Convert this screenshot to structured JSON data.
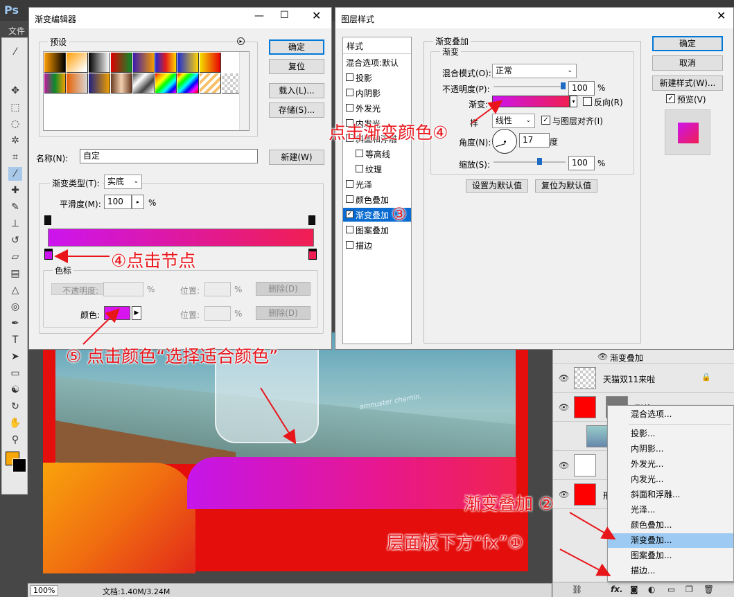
{
  "app": {
    "logo": "Ps",
    "menu_first": "文件"
  },
  "canvas": {
    "jar_text": "amnuster chemin."
  },
  "status_bar": {
    "zoom": "100%",
    "doc_info": "文档:1.40M/3.24M"
  },
  "layers_panel": {
    "effect_header": "渐变叠加",
    "rows": [
      {
        "name": "天猫双11来啦"
      },
      {
        "name": "形状 3"
      },
      {
        "name": ""
      },
      {
        "name": ""
      },
      {
        "name": "形"
      }
    ]
  },
  "fx_menu": {
    "items": [
      "混合选项...",
      "投影...",
      "内阴影...",
      "外发光...",
      "内发光...",
      "斜面和浮雕...",
      "光泽...",
      "颜色叠加...",
      "渐变叠加...",
      "图案叠加...",
      "描边..."
    ],
    "selected": "渐变叠加..."
  },
  "gradient_editor": {
    "title": "渐变编辑器",
    "presets_label": "预设",
    "buttons": {
      "ok": "确定",
      "reset": "复位",
      "load": "载入(L)...",
      "save": "存储(S)...",
      "new": "新建(W)"
    },
    "name_label": "名称(N):",
    "name_value": "自定",
    "type_label": "渐变类型(T):",
    "type_value": "实底",
    "smooth_label": "平滑度(M):",
    "smooth_value": "100",
    "smooth_unit": "%",
    "gradient_colors": {
      "start": "#cc14ee",
      "end": "#f01e52"
    },
    "stops_group": "色标",
    "opacity_label": "不透明度:",
    "opacity_unit": "%",
    "location_label": "位置:",
    "location_unit": "%",
    "delete_label": "删除(D)",
    "color_label": "颜色:",
    "color_value": "#d815ee"
  },
  "layer_style": {
    "title": "图层样式",
    "sidebar_header": "样式",
    "sidebar_items": [
      {
        "label": "混合选项:默认",
        "check": false,
        "indent": false,
        "has_box": false
      },
      {
        "label": "投影",
        "check": false,
        "indent": false,
        "has_box": true
      },
      {
        "label": "内阴影",
        "check": false,
        "indent": false,
        "has_box": true
      },
      {
        "label": "外发光",
        "check": false,
        "indent": false,
        "has_box": true
      },
      {
        "label": "内发光",
        "check": false,
        "indent": false,
        "has_box": true
      },
      {
        "label": "斜面和浮雕",
        "check": false,
        "indent": false,
        "has_box": true
      },
      {
        "label": "等高线",
        "check": false,
        "indent": true,
        "has_box": true
      },
      {
        "label": "纹理",
        "check": false,
        "indent": true,
        "has_box": true
      },
      {
        "label": "光泽",
        "check": false,
        "indent": false,
        "has_box": true
      },
      {
        "label": "颜色叠加",
        "check": false,
        "indent": false,
        "has_box": true
      },
      {
        "label": "渐变叠加",
        "check": true,
        "indent": false,
        "has_box": true,
        "selected": true
      },
      {
        "label": "图案叠加",
        "check": false,
        "indent": false,
        "has_box": true
      },
      {
        "label": "描边",
        "check": false,
        "indent": false,
        "has_box": true
      }
    ],
    "section_title": "渐变叠加",
    "subsection_title": "渐变",
    "blend_label": "混合模式(O):",
    "blend_value": "正常",
    "opacity_label": "不透明度(P):",
    "opacity_value": "100",
    "opacity_unit": "%",
    "opacity_level": 1.0,
    "gradient_label": "渐变:",
    "reverse_label": "反向(R)",
    "style_label": "样",
    "style_value": "线性",
    "align_label": "与图层对齐(I)",
    "align_checked": true,
    "angle_label": "角度(N):",
    "angle_value": "17",
    "angle_unit": "度",
    "scale_label": "缩放(S):",
    "scale_value": "100",
    "scale_unit": "%",
    "scale_level": 0.65,
    "btn_default": "设置为默认值",
    "btn_reset_default": "复位为默认值",
    "buttons": {
      "ok": "确定",
      "cancel": "取消",
      "new_style": "新建样式(W)...",
      "preview": "预览(V)"
    },
    "preview_checked": true
  },
  "annotations": {
    "a1": "层面板下方“fx”①",
    "a2": "渐变叠加 ②",
    "a3": "③",
    "a4_top": "点击渐变颜色④",
    "a4_stop": "④点击节点",
    "a5": "⑤ 点击颜色“选择适合颜色”"
  },
  "accent": "#0078d7"
}
